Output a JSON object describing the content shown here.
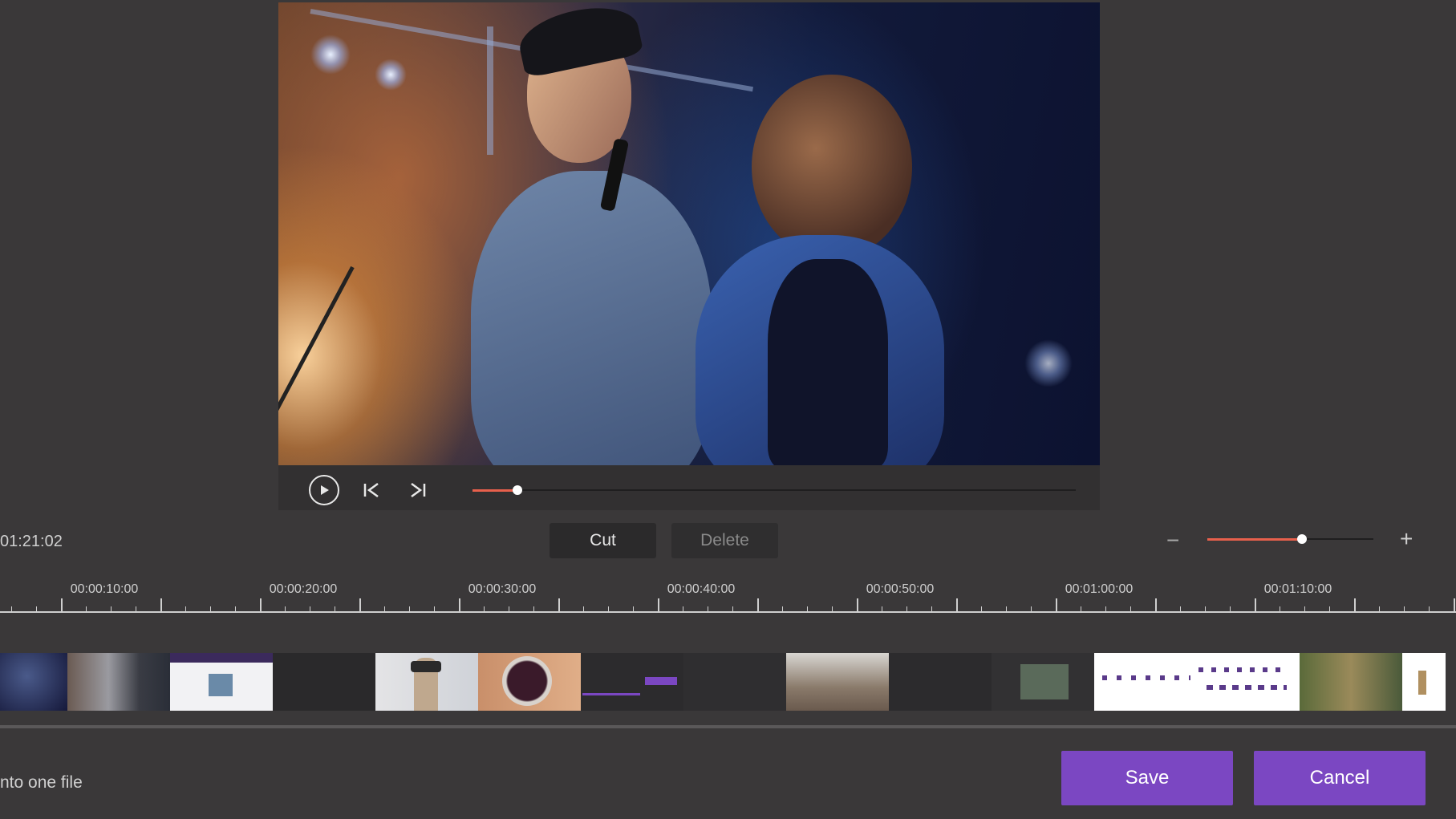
{
  "player": {
    "progress": 0.075,
    "play_icon": "play-icon",
    "prev_icon": "skip-back-icon",
    "next_icon": "skip-forward-icon"
  },
  "toolbar": {
    "timecode": "01:21:02",
    "cut_label": "Cut",
    "delete_label": "Delete",
    "zoom_level": 0.57,
    "zoom_out_label": "−",
    "zoom_in_label": "+"
  },
  "timeline": {
    "ticks": [
      "00:00:10:00",
      "00:00:20:00",
      "00:00:30:00",
      "00:00:40:00",
      "00:00:50:00",
      "00:01:00:00",
      "00:01:10:00"
    ]
  },
  "bottom": {
    "merge_label": "nto one file",
    "save_label": "Save",
    "cancel_label": "Cancel"
  },
  "colors": {
    "accent": "#7b47c2",
    "slider": "#e8604c"
  }
}
